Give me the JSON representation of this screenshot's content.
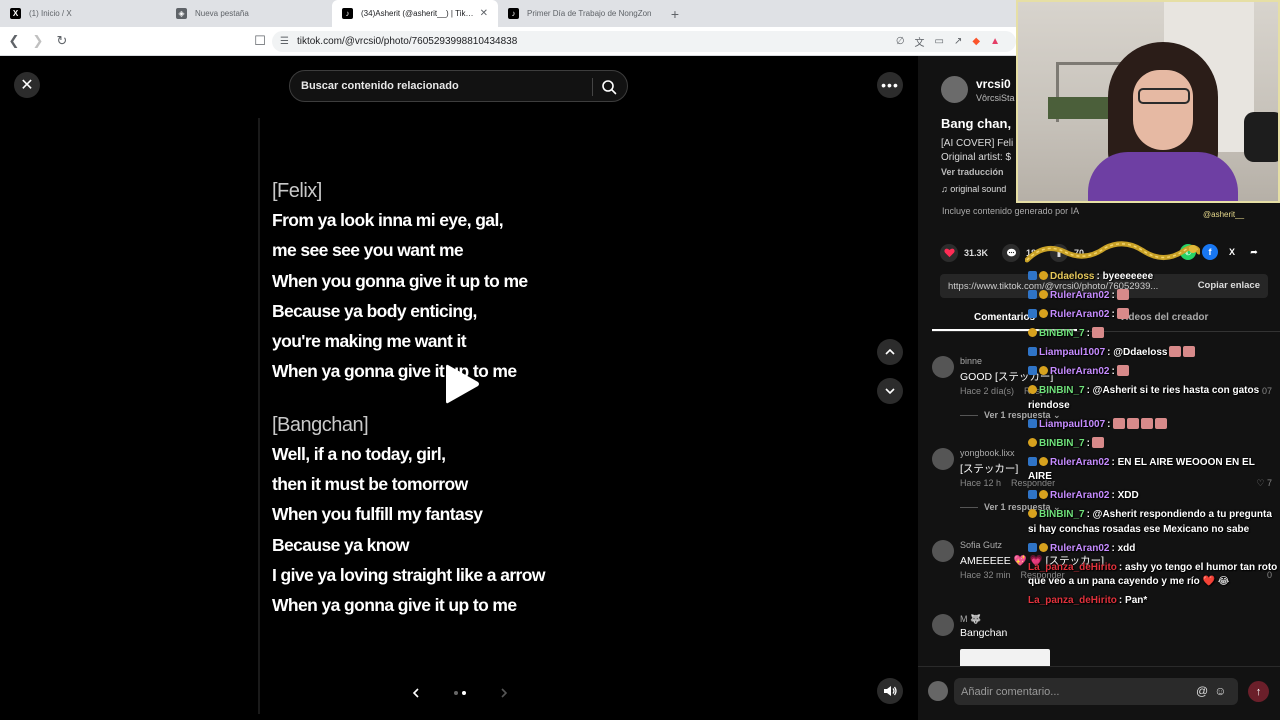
{
  "browser": {
    "tabs": [
      {
        "title": "(1) Inicio / X",
        "icon": "x-logo-icon",
        "icon_char": "X",
        "color": "#000000",
        "active": false
      },
      {
        "title": "Nueva pestaña",
        "icon": "shield-icon",
        "icon_char": "◈",
        "color": "#5f6368",
        "active": false
      },
      {
        "title": "(34)Asherit (@asherit__) | TikTok",
        "icon": "tiktok-logo-icon",
        "icon_char": "♪",
        "color": "#000000",
        "active": true
      },
      {
        "title": "Primer Día de Trabajo de NongZon",
        "icon": "tiktok-logo-icon",
        "icon_char": "♪",
        "color": "#000000",
        "active": false
      }
    ],
    "url": "tiktok.com/@vrcsi0/photo/7605293998810434838"
  },
  "viewer": {
    "search_placeholder": "Buscar contenido relacionado",
    "lyrics": [
      {
        "type": "section",
        "text": "[Felix]"
      },
      {
        "type": "line",
        "text": "From ya look inna mi eye, gal,"
      },
      {
        "type": "line",
        "text": "me see see you want me"
      },
      {
        "type": "line",
        "text": "When you gonna give it up to me"
      },
      {
        "type": "line",
        "text": "Because ya body enticing,"
      },
      {
        "type": "line",
        "text": "you're making me want it"
      },
      {
        "type": "line",
        "text": "When ya gonna give it up to me"
      },
      {
        "type": "gap",
        "text": ""
      },
      {
        "type": "section",
        "text": "[Bangchan]"
      },
      {
        "type": "line",
        "text": "Well, if a no today, girl,"
      },
      {
        "type": "line",
        "text": "then it must be tomorrow"
      },
      {
        "type": "line",
        "text": "When you fulfill my fantasy"
      },
      {
        "type": "line",
        "text": "Because ya know"
      },
      {
        "type": "line",
        "text": "I give ya loving straight like a arrow"
      },
      {
        "type": "line",
        "text": "When ya gonna give it up to me"
      }
    ],
    "page_index": 2,
    "page_count": 2
  },
  "panel": {
    "author_name": "vrcsi0",
    "author_handle": "VôrcsiSta",
    "title": "Bang chan,",
    "desc_line1": "[AI COVER] Feli",
    "desc_line2": "Original artist: $",
    "translate": "Ver traducción",
    "sound": "♫  original sound",
    "ai_note": "Incluye contenido generado por IA",
    "likes": "31.3K",
    "comments_count": "18",
    "shares_count": "70",
    "link": "https://www.tiktok.com/@vrcsi0/photo/76052939...",
    "copy_label": "Copiar enlace",
    "tabs": [
      "Comentarios",
      "Videos del creador"
    ],
    "comments": [
      {
        "name": "binne",
        "text": "GOOD [ステッカー]",
        "time": "Hace 2 día(s)",
        "reply": "Responder",
        "likes": "07",
        "replies": "Ver 1 respuesta ⌄"
      },
      {
        "name": "yongbook.lixx",
        "text": "[ステッカー]",
        "time": "Hace 12 h",
        "reply": "Responder",
        "likes": "♡ 7",
        "replies": "Ver 1 respuesta ⌄"
      },
      {
        "name": "Sofia Gutz",
        "text": "AMEEEEE 💖 💗 [ステッカー]",
        "time": "Hace 32 min",
        "reply": "Responder",
        "likes": "0",
        "replies": ""
      },
      {
        "name": "M 🐺",
        "text": "Bangchan",
        "time": "",
        "reply": "",
        "likes": "",
        "replies": ""
      }
    ],
    "input_placeholder": "Añadir comentario..."
  },
  "stream": {
    "handle": "@asherit__",
    "chat": [
      {
        "user": "Ddaeloss",
        "color": "#e6c85a",
        "badges": [
          "blue",
          "gold"
        ],
        "text": ": byeeeeeee",
        "emotes": 0
      },
      {
        "user": "RulerAran02",
        "color": "#c68cff",
        "badges": [
          "blue",
          "gold"
        ],
        "text": ":",
        "emotes": 1
      },
      {
        "user": "RulerAran02",
        "color": "#c68cff",
        "badges": [
          "blue",
          "gold"
        ],
        "text": ":",
        "emotes": 1
      },
      {
        "user": "BINBIN_7",
        "color": "#6fe07a",
        "badges": [
          "gold"
        ],
        "text": ":",
        "emotes": 1
      },
      {
        "user": "Liampaul1007",
        "color": "#c68cff",
        "badges": [
          "blue"
        ],
        "text": ": @Ddaeloss",
        "emotes": 2
      },
      {
        "user": "RulerAran02",
        "color": "#c68cff",
        "badges": [
          "blue",
          "gold"
        ],
        "text": ":",
        "emotes": 1
      },
      {
        "user": "BINBIN_7",
        "color": "#6fe07a",
        "badges": [
          "gold"
        ],
        "text": ": @Asherit si te ries hasta con gatos riendose",
        "emotes": 0
      },
      {
        "user": "Liampaul1007",
        "color": "#c68cff",
        "badges": [
          "blue"
        ],
        "text": ":",
        "emotes": 4
      },
      {
        "user": "BINBIN_7",
        "color": "#6fe07a",
        "badges": [
          "gold"
        ],
        "text": ":",
        "emotes": 1
      },
      {
        "user": "RulerAran02",
        "color": "#c68cff",
        "badges": [
          "blue",
          "gold"
        ],
        "text": ": EN EL AIRE WEOOON EN EL AIRE",
        "emotes": 0
      },
      {
        "user": "RulerAran02",
        "color": "#c68cff",
        "badges": [
          "blue",
          "gold"
        ],
        "text": ": XDD",
        "emotes": 0
      },
      {
        "user": "BINBIN_7",
        "color": "#6fe07a",
        "badges": [
          "gold"
        ],
        "text": ": @Asherit respondiendo a tu pregunta si hay conchas rosadas ese Mexicano no sabe",
        "emotes": 0
      },
      {
        "user": "RulerAran02",
        "color": "#c68cff",
        "badges": [
          "blue",
          "gold"
        ],
        "text": ": xdd",
        "emotes": 0
      },
      {
        "user": "La_panza_deHirito",
        "color": "#e0323c",
        "badges": [],
        "text": ": ashy yo tengo el humor tan roto que veo a un pana cayendo y me río ❤️ 😂",
        "emotes": 0
      },
      {
        "user": "La_panza_deHirito",
        "color": "#e0323c",
        "badges": [],
        "text": ": Pan*",
        "emotes": 0
      }
    ]
  },
  "colors": {
    "page_bg": "#000000",
    "panel_bg": "#121212",
    "like_red": "#fe2c55",
    "cam_border": "#e6dfa5"
  }
}
